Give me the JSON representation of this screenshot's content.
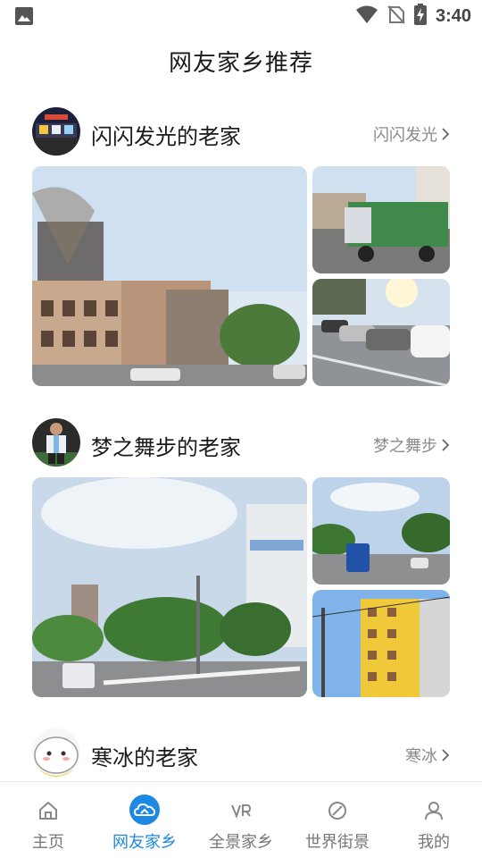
{
  "status_bar": {
    "time": "3:40",
    "icons": [
      "image-icon",
      "wifi-icon",
      "no-sim-icon",
      "battery-charging-icon"
    ]
  },
  "page": {
    "title": "网友家乡推荐"
  },
  "cards": [
    {
      "title": "闪闪发光的老家",
      "more": "闪闪发光",
      "avatar": "night-storefront-avatar"
    },
    {
      "title": "梦之舞步的老家",
      "more": "梦之舞步",
      "avatar": "football-player-avatar"
    },
    {
      "title": "寒冰的老家",
      "more": "寒冰",
      "avatar": "cartoon-cat-avatar"
    }
  ],
  "bottom_nav": {
    "items": [
      {
        "label": "主页",
        "icon": "home-icon",
        "active": false
      },
      {
        "label": "网友家乡",
        "icon": "cloud-home-icon",
        "active": true
      },
      {
        "label": "全景家乡",
        "icon": "vr-icon",
        "active": false
      },
      {
        "label": "世界街景",
        "icon": "compass-leaf-icon",
        "active": false
      },
      {
        "label": "我的",
        "icon": "user-icon",
        "active": false
      }
    ]
  },
  "colors": {
    "accent": "#1e88e5",
    "muted": "#8a8a8a",
    "title": "#1a1a1a"
  }
}
